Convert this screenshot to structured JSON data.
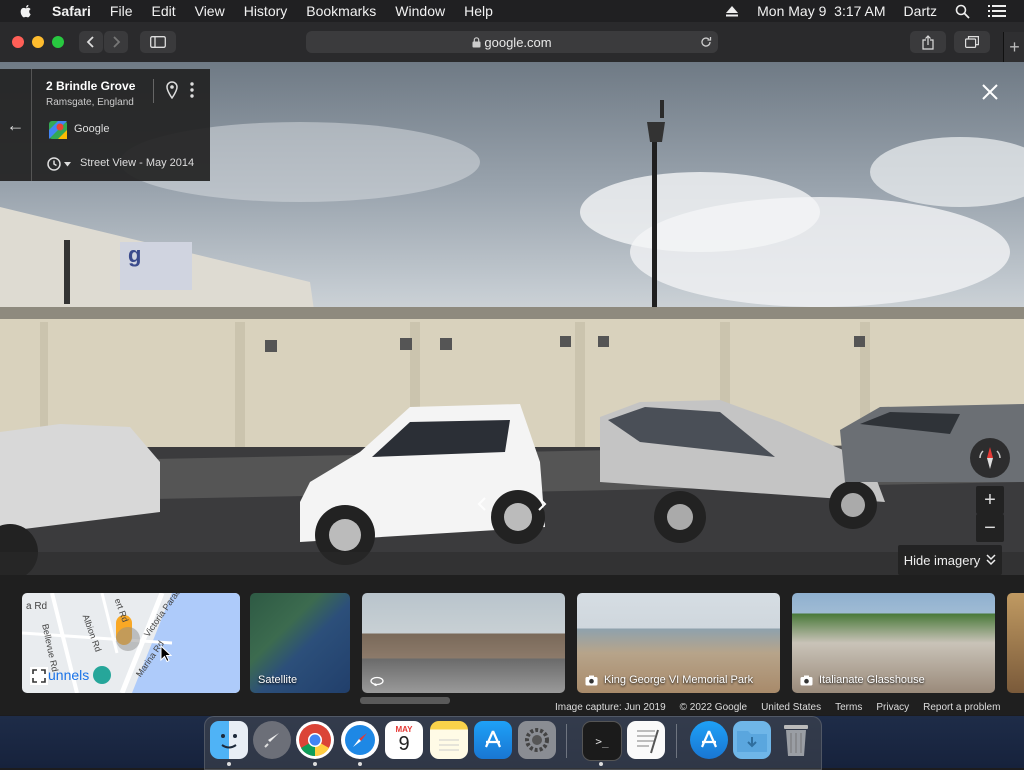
{
  "menubar": {
    "app": "Safari",
    "items": [
      "File",
      "Edit",
      "View",
      "History",
      "Bookmarks",
      "Window",
      "Help"
    ],
    "clock": "Mon May 9  3:17 AM",
    "user": "Dartz"
  },
  "toolbar": {
    "url": "google.com"
  },
  "streetview": {
    "address": "2 Brindle Grove",
    "locality": "Ramsgate, England",
    "contributor": "Google",
    "capture": "Street View - May 2014",
    "hide_imagery": "Hide imagery",
    "map_label": "unnels",
    "map_streets": [
      "Bellevue Rd",
      "Albion Rd",
      "Victoria Parade",
      "Marina Rd",
      "a Rd",
      "ert Rd"
    ],
    "thumbnails": [
      {
        "label": "Satellite"
      },
      {
        "label": ""
      },
      {
        "label": "King George VI Memorial Park"
      },
      {
        "label": "Italianate Glasshouse"
      }
    ]
  },
  "footer": {
    "capture": "Image capture: Jun 2019",
    "copyright": "© 2022 Google",
    "region": "United States",
    "terms": "Terms",
    "privacy": "Privacy",
    "report": "Report a problem"
  },
  "dock": {
    "calendar_month": "MAY",
    "calendar_day": "9",
    "apps": [
      "finder",
      "launchpad",
      "chrome",
      "safari",
      "calendar",
      "notes",
      "app-store",
      "system-preferences",
      "terminal",
      "textedit",
      "app-store-2",
      "downloads",
      "trash"
    ]
  }
}
